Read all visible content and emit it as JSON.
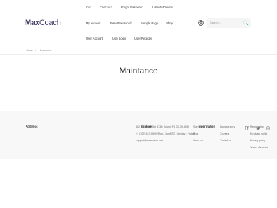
{
  "header": {
    "logo": {
      "part1": "Max",
      "part2": "Coach"
    },
    "nav_row1": [
      "Cart",
      "Checkout",
      "Forgot Password",
      "Lista de Deseos"
    ],
    "nav_row2": [
      "My account",
      "Reset Password",
      "Sample Page",
      "Shop"
    ],
    "nav_row3": [
      "User Account",
      "User Login",
      "User Register"
    ],
    "search": {
      "placeholder": "Search..."
    },
    "icons": {
      "user": "user-icon",
      "search": "search-icon"
    }
  },
  "breadcrumb": {
    "home": "Home",
    "separator": "/",
    "current": "Maintance"
  },
  "page": {
    "title": "Maintance"
  },
  "footer": {
    "address_heading": "Address",
    "address_lines": [
      "382 NE 191st St # 87394 Miami, FL 33179-3899",
      "+1 (302) 547-9909 (Mon - 3pm EST, Monday - Friday)",
      "support@maxcoach.com"
    ],
    "explore_heading": "Explore",
    "explore_items": [
      "Start here",
      "Blog",
      "About us"
    ],
    "information_heading": "Information",
    "information_items": [
      "Success story",
      "Courses",
      "Contact us"
    ],
    "links_items": [
      "Membership",
      "Purchase guide",
      "Privacy policy",
      "Terms of service"
    ],
    "social_icons": [
      "facebook-icon",
      "twitter-icon",
      "instagram-icon"
    ]
  }
}
